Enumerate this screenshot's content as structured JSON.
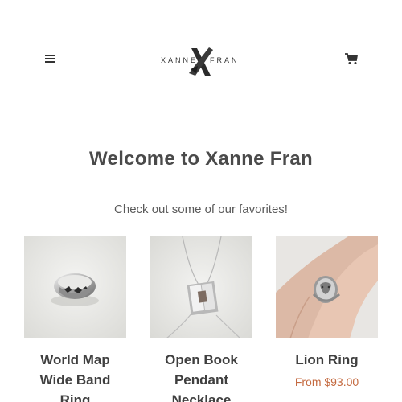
{
  "header": {
    "menu_icon": "hamburger-icon",
    "logo_text_left": "XANNE",
    "logo_text_right": "FRAN",
    "logo_mark": "X",
    "cart_icon": "cart-icon"
  },
  "hero": {
    "title": "Welcome to Xanne Fran",
    "subtitle": "Check out some of our favorites!"
  },
  "products": [
    {
      "name": "World Map Wide Band Ring",
      "price": ""
    },
    {
      "name": "Open Book Pendant Necklace",
      "price": ""
    },
    {
      "name": "Lion Ring",
      "price": "From $93.00"
    }
  ],
  "colors": {
    "text": "#4a4a4a",
    "price": "#c46a40",
    "divider": "#c8c8c8"
  }
}
